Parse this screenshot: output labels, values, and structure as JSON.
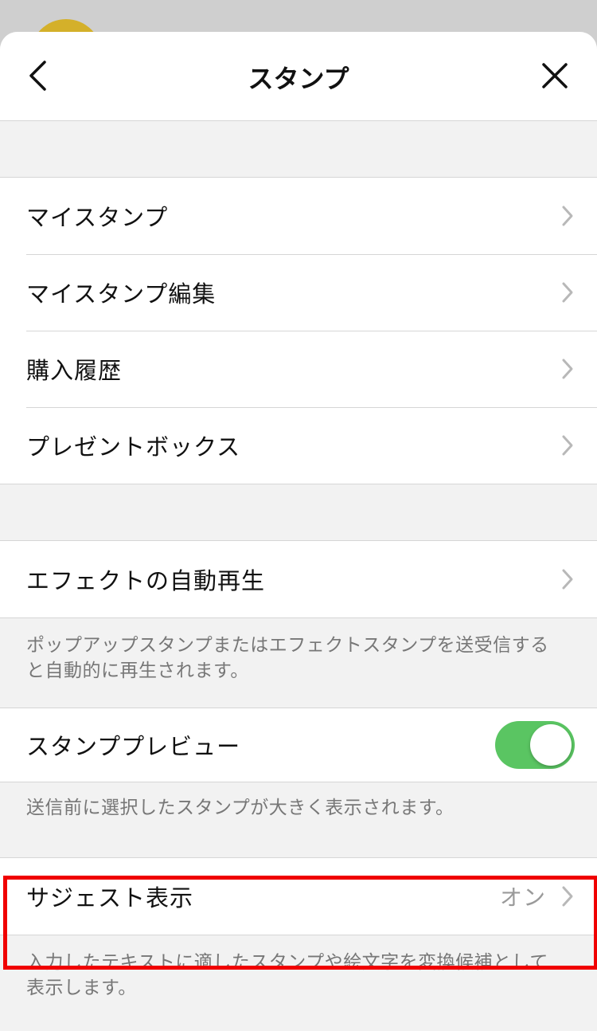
{
  "header": {
    "title": "スタンプ"
  },
  "group1": {
    "items": [
      {
        "label": "マイスタンプ"
      },
      {
        "label": "マイスタンプ編集"
      },
      {
        "label": "購入履歴"
      },
      {
        "label": "プレゼントボックス"
      }
    ]
  },
  "effect": {
    "label": "エフェクトの自動再生",
    "note_line1": "ポップアップスタンプまたはエフェクトスタンプを送受信する",
    "note_line2": "と自動的に再生されます。"
  },
  "preview": {
    "label": "スタンププレビュー",
    "enabled": true,
    "toggle_color": "#5ac562",
    "note": "送信前に選択したスタンプが大きく表示されます。"
  },
  "suggest": {
    "label": "サジェスト表示",
    "value": "オン",
    "note_line1": "入力したテキストに適したスタンプや絵文字を変換候補として",
    "note_line2": "表示します。"
  },
  "icons": {
    "back": "chevron-left-icon",
    "close": "close-icon",
    "row_chevron": "chevron-right-icon"
  },
  "highlight_color": "#f00000"
}
